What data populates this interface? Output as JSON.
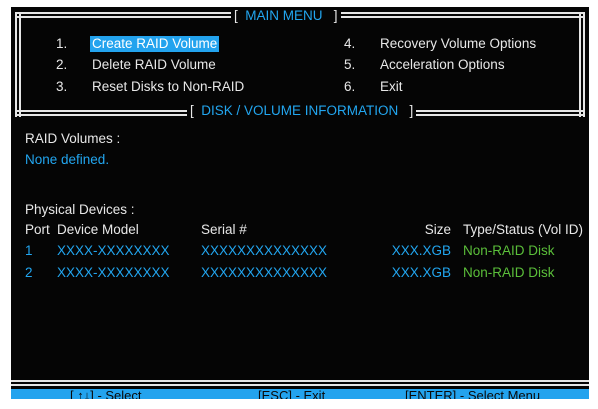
{
  "main_menu": {
    "title": "MAIN MENU",
    "left_items": [
      {
        "num": "1.",
        "label": "Create RAID Volume",
        "selected": true
      },
      {
        "num": "2.",
        "label": "Delete RAID Volume"
      },
      {
        "num": "3.",
        "label": "Reset Disks to Non-RAID"
      }
    ],
    "right_items": [
      {
        "num": "4.",
        "label": "Recovery Volume Options"
      },
      {
        "num": "5.",
        "label": "Acceleration Options"
      },
      {
        "num": "6.",
        "label": "Exit"
      }
    ]
  },
  "info": {
    "title": "DISK / VOLUME INFORMATION",
    "raid_volumes_label": "RAID Volumes :",
    "raid_volumes_value": "None defined.",
    "physical_devices_label": "Physical Devices :",
    "columns": {
      "port": "Port",
      "model": "Device Model",
      "serial": "Serial #",
      "size": "Size",
      "type": "Type/Status (Vol ID)"
    },
    "devices": [
      {
        "port": "1",
        "model": "XXXX-XXXXXXXX",
        "serial": "XXXXXXXXXXXXXX",
        "size": "XXX.XGB",
        "type": "Non-RAID Disk"
      },
      {
        "port": "2",
        "model": "XXXX-XXXXXXXX",
        "serial": "XXXXXXXXXXXXXX",
        "size": "XXX.XGB",
        "type": "Non-RAID Disk"
      }
    ]
  },
  "footer": {
    "select": "[ ↑↓] - Select",
    "exit": "[ESC] - Exit",
    "enter": "[ENTER] - Select Menu"
  },
  "colors": {
    "background": "#050505",
    "text": "#e8e8e8",
    "accent": "#22a6f0",
    "status": "#5bbf3a"
  }
}
